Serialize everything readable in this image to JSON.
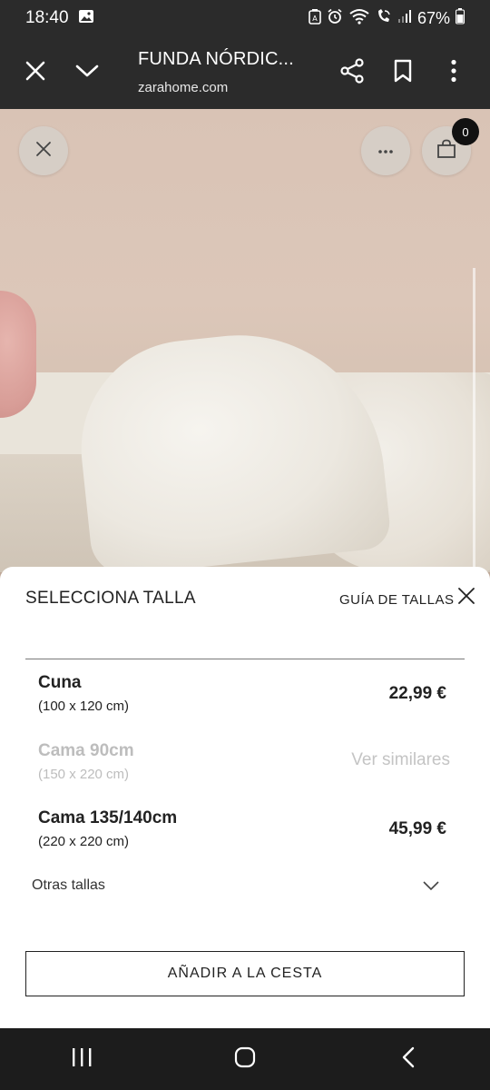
{
  "status_bar": {
    "time": "18:40",
    "battery": "67%",
    "icons": [
      "gallery-icon",
      "data-saver-icon",
      "alarm-icon",
      "wifi-icon",
      "wifi-call-icon",
      "signal-icon",
      "battery-icon"
    ]
  },
  "tab_bar": {
    "title": "FUNDA NÓRDIC...",
    "url": "zarahome.com",
    "icons": [
      "close-icon",
      "chevron-down-icon",
      "share-icon",
      "bookmark-icon",
      "more-vert-icon"
    ]
  },
  "hero": {
    "cart_count": "0",
    "icons": [
      "close-icon",
      "more-horiz-icon",
      "bag-icon"
    ]
  },
  "sheet": {
    "title": "SELECCIONA TALLA",
    "size_guide": "GUÍA DE TALLAS",
    "sizes": [
      {
        "name": "Cuna",
        "dimensions": "(100 x 120 cm)",
        "price": "22,99 €",
        "available": true
      },
      {
        "name": "Cama 90cm",
        "dimensions": "(150 x 220 cm)",
        "alt_text": "Ver similares",
        "available": false
      },
      {
        "name": "Cama 135/140cm",
        "dimensions": "(220 x 220 cm)",
        "price": "45,99 €",
        "available": true
      }
    ],
    "other_sizes_label": "Otras tallas",
    "add_to_cart_label": "AÑADIR A LA CESTA"
  },
  "nav_bar": {
    "icons": [
      "recent-apps-icon",
      "home-icon",
      "back-icon"
    ]
  },
  "colors": {
    "status_bg": "#2b2b2b",
    "nav_bg": "#1c1c1c",
    "text_dark": "#222222",
    "text_disabled": "#bdbdbd"
  }
}
